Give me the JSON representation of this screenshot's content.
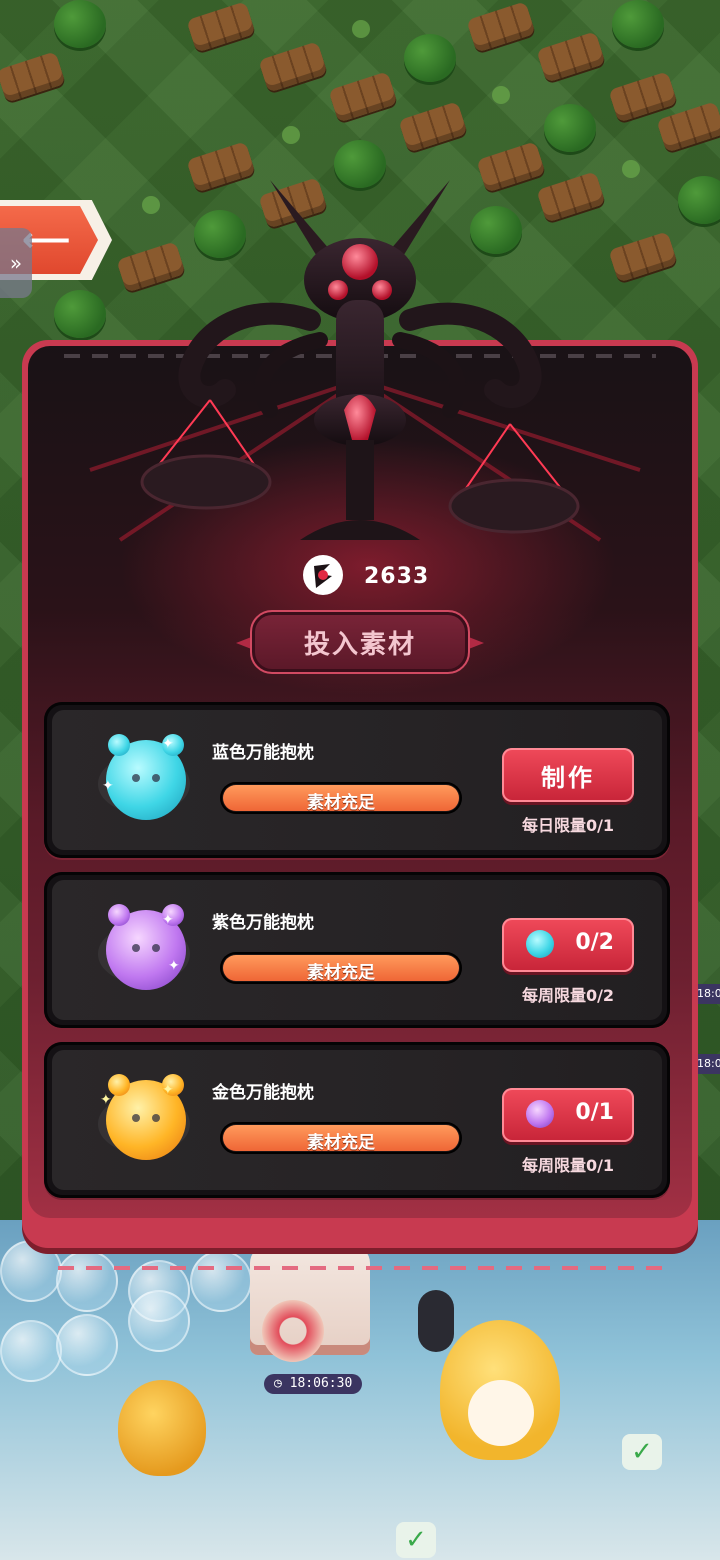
{
  "world": {
    "timer": "18:06:30",
    "side_timer_1": "18:0",
    "side_timer_2": "18:0"
  },
  "back_button": {
    "icon": "back-arrow-icon"
  },
  "panel": {
    "currency": {
      "icon": "scale-token-icon",
      "value": "2633"
    },
    "invest_button": "投入素材",
    "recipes": [
      {
        "name": "蓝色万能抱枕",
        "material_status": "素材充足",
        "material_fill": 1.0,
        "action": {
          "type": "craft",
          "label": "制作"
        },
        "limit": "每日限量0/1",
        "color": "#3fd6e6"
      },
      {
        "name": "紫色万能抱枕",
        "material_status": "素材充足",
        "material_fill": 1.0,
        "action": {
          "type": "cost",
          "icon": "blue-pillow-icon",
          "count": "0/2"
        },
        "limit": "每周限量0/2",
        "color": "#c078f0"
      },
      {
        "name": "金色万能抱枕",
        "material_status": "素材充足",
        "material_fill": 1.0,
        "action": {
          "type": "cost",
          "icon": "purple-pillow-icon",
          "count": "0/1"
        },
        "limit": "每周限量0/1",
        "color": "#ffb526"
      }
    ]
  }
}
